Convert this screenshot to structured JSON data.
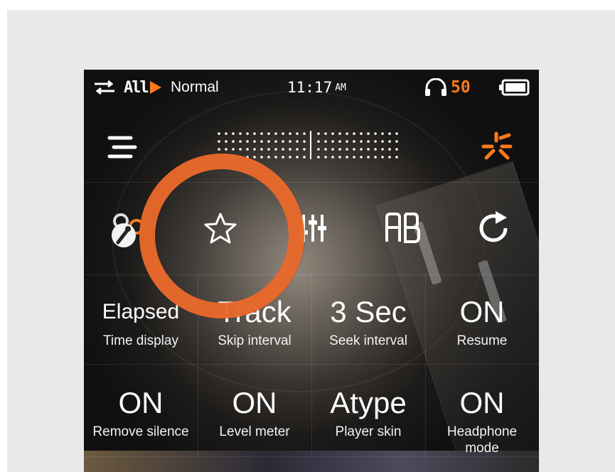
{
  "status_bar": {
    "repeat_icon": "repeat-icon",
    "repeat_mode": "All",
    "play_icon": "play-icon",
    "play_mode": "Normal",
    "time": "11:17",
    "ampm": "AM",
    "headphone_icon": "headphone-icon",
    "volume": "50",
    "battery_icon": "battery-icon"
  },
  "header": {
    "menu_icon": "menu-icon",
    "logo_icon": "brand-logo-icon"
  },
  "quick_icons": [
    "settings-lock-icon",
    "star-icon",
    "equalizer-icon",
    "ab-repeat-icon",
    "refresh-icon"
  ],
  "settings": [
    {
      "value": "Elapsed",
      "label": "Time display"
    },
    {
      "value": "Track",
      "label": "Skip interval"
    },
    {
      "value": "3 Sec",
      "label": "Seek interval"
    },
    {
      "value": "ON",
      "label": "Resume"
    },
    {
      "value": "ON",
      "label": "Remove silence"
    },
    {
      "value": "ON",
      "label": "Level meter"
    },
    {
      "value": "Atype",
      "label": "Player skin"
    },
    {
      "value": "ON",
      "label": "Headphone mode"
    }
  ],
  "colors": {
    "accent": "#ff7a1e",
    "highlight_ring": "#e8692b",
    "text": "#ffffff",
    "frame_background": "#e9e9e9"
  }
}
